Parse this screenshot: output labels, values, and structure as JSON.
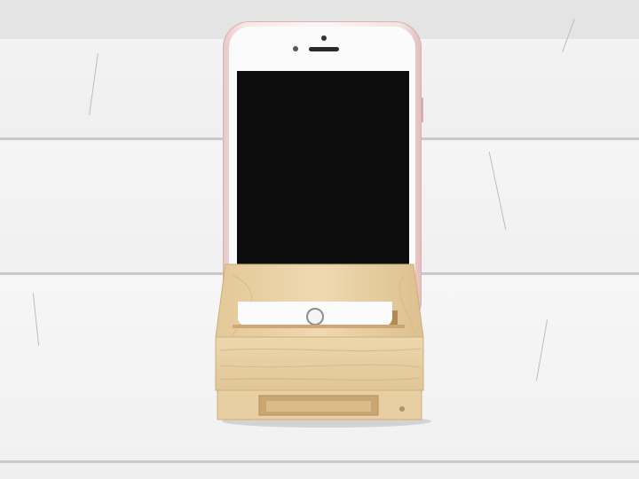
{
  "scene": {
    "subject": "smartphone-in-wooden-stand",
    "colors": {
      "wall": "#f1f1f1",
      "wall_shadow": "#d2d2d2",
      "phone_frame": "#f4dcdb",
      "screen": "#0d0d0d",
      "wood_light": "#ecd6ad",
      "wood_dark": "#d9bd8d",
      "wood_edge": "#c9a46f"
    }
  }
}
